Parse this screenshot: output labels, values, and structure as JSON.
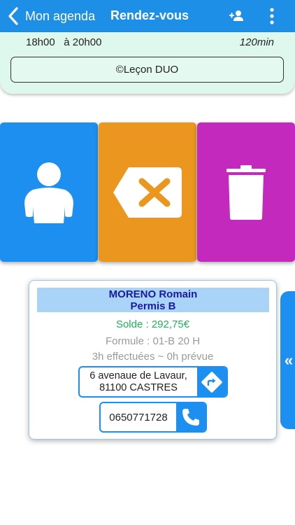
{
  "header": {
    "back_label": "Mon agenda",
    "title": "Rendez-vous",
    "bg_color": "#1e8fe6",
    "icons": [
      "chevron-left-icon",
      "person-add-icon",
      "more-vertical-icon"
    ]
  },
  "appointment": {
    "start": "18h00",
    "end": "à 20h00",
    "duration": "120min",
    "lesson": "©Leçon DUO"
  },
  "actions": [
    {
      "name": "student",
      "icon": "person-icon",
      "color": "#1d8ff0"
    },
    {
      "name": "cancel",
      "icon": "backspace-x-icon",
      "color": "#ea961f"
    },
    {
      "name": "delete",
      "icon": "trash-icon",
      "color": "#c429be"
    }
  ],
  "student": {
    "name": "MORENO Romain",
    "permit": "Permis B",
    "solde": "Solde : 292,75€",
    "formule": "Formule : 01-B 20 H",
    "hours": "3h effectuées ~ 0h prévue",
    "address_line1": "6 avenaue de Lavaur,",
    "address_line2": "81100 CASTRES",
    "phone": "0650771728"
  },
  "side_tab": {
    "label": "«"
  }
}
